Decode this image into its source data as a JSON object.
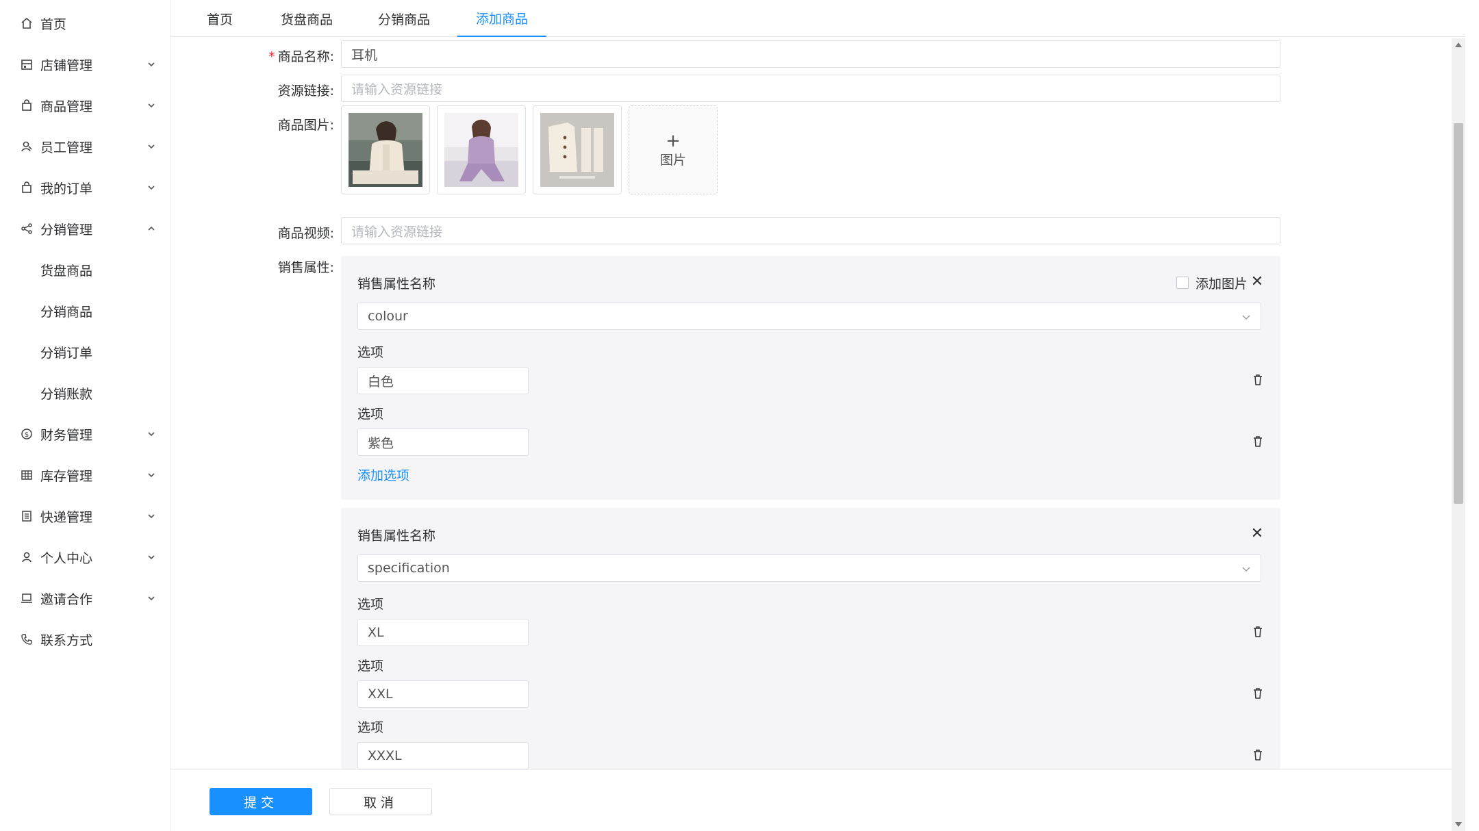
{
  "sidebar": {
    "items": [
      {
        "label": "首页",
        "icon": "home-icon"
      },
      {
        "label": "店铺管理",
        "icon": "store-icon"
      },
      {
        "label": "商品管理",
        "icon": "bag-icon"
      },
      {
        "label": "员工管理",
        "icon": "staff-icon"
      },
      {
        "label": "我的订单",
        "icon": "order-bag-icon"
      },
      {
        "label": "分销管理",
        "icon": "share-icon",
        "expanded": true,
        "children": [
          "货盘商品",
          "分销商品",
          "分销订单",
          "分销账款"
        ]
      },
      {
        "label": "财务管理",
        "icon": "dollar-icon"
      },
      {
        "label": "库存管理",
        "icon": "grid-icon"
      },
      {
        "label": "快递管理",
        "icon": "list-icon"
      },
      {
        "label": "个人中心",
        "icon": "user-icon"
      },
      {
        "label": "邀请合作",
        "icon": "laptop-icon"
      },
      {
        "label": "联系方式",
        "icon": "phone-icon"
      }
    ]
  },
  "tabs": [
    "首页",
    "货盘商品",
    "分销商品",
    "添加商品"
  ],
  "active_tab": "添加商品",
  "form": {
    "name_label": "商品名称:",
    "name_value": "耳机",
    "link_label": "资源链接:",
    "link_placeholder": "请输入资源链接",
    "images_label": "商品图片:",
    "upload_label": "图片",
    "video_label": "商品视频:",
    "video_placeholder": "请输入资源链接",
    "sales_attr_label": "销售属性:"
  },
  "attributes": [
    {
      "title": "销售属性名称",
      "value": "colour",
      "add_image_label": "添加图片",
      "option_label": "选项",
      "options": [
        "白色",
        "紫色"
      ],
      "add_option_label": "添加选项"
    },
    {
      "title": "销售属性名称",
      "value": "specification",
      "option_label": "选项",
      "options": [
        "XL",
        "XXL",
        "XXXL"
      ]
    }
  ],
  "footer": {
    "submit_label": "提交",
    "cancel_label": "取消"
  },
  "colors": {
    "accent": "#1890ff",
    "required": "#f5222d"
  }
}
